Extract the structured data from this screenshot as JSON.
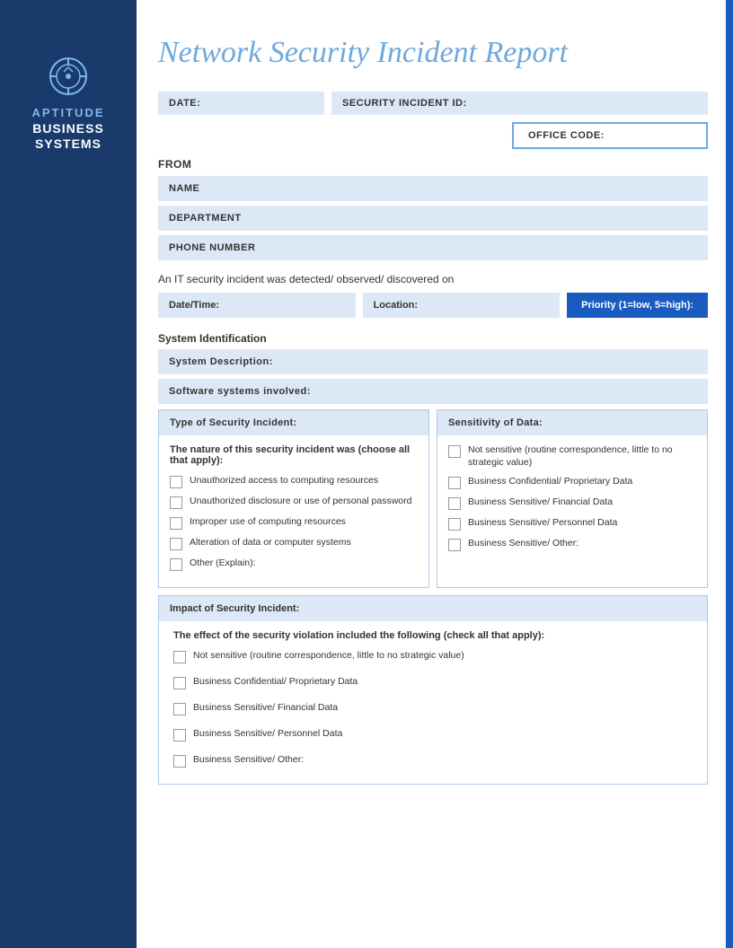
{
  "sidebar": {
    "aptitude_label": "APTITUDE",
    "business_label": "BUSINESS\nSYSTEMS"
  },
  "header": {
    "title": "Network Security Incident Report"
  },
  "form": {
    "date_label": "DATE:",
    "security_incident_id_label": "SECURITY INCIDENT ID:",
    "office_code_label": "OFFICE CODE:",
    "from_label": "FROM",
    "name_label": "NAME",
    "department_label": "DEPARTMENT",
    "phone_label": "PHONE NUMBER",
    "detected_text": "An IT security incident was detected/ observed/ discovered on",
    "date_time_label": "Date/Time:",
    "location_label": "Location:",
    "priority_label": "Priority (1=low, 5=high):",
    "system_id_title": "System Identification",
    "system_desc_label": "System Description:",
    "software_label": "Software systems involved:",
    "incident_type_header": "Type of Security Incident:",
    "sensitivity_header": "Sensitivity of Data:",
    "nature_text": "The nature of this security incident was (choose all that apply):",
    "incident_checkboxes": [
      "Unauthorized access to computing resources",
      "Unauthorized disclosure or use of personal password",
      "Improper use of computing resources",
      "Alteration of data or computer systems",
      "Other (Explain):"
    ],
    "sensitivity_checkboxes": [
      "Not sensitive (routine correspondence, little to no strategic value)",
      "Business Confidential/ Proprietary Data",
      "Business Sensitive/ Financial Data",
      "Business Sensitive/ Personnel Data",
      "Business Sensitive/ Other:"
    ],
    "impact_header": "Impact of Security Incident:",
    "effect_text": "The effect of the security violation included the following (check all that apply):",
    "impact_checkboxes": [
      "Not sensitive (routine correspondence, little to no strategic value)",
      "Business Confidential/ Proprietary Data",
      "Business Sensitive/ Financial Data",
      "Business Sensitive/ Personnel Data",
      "Business Sensitive/ Other:"
    ]
  },
  "colors": {
    "sidebar_bg": "#1a3a6b",
    "accent_blue": "#1a5bbf",
    "light_blue": "#6fa8dc",
    "field_bg": "#dce8f5"
  }
}
